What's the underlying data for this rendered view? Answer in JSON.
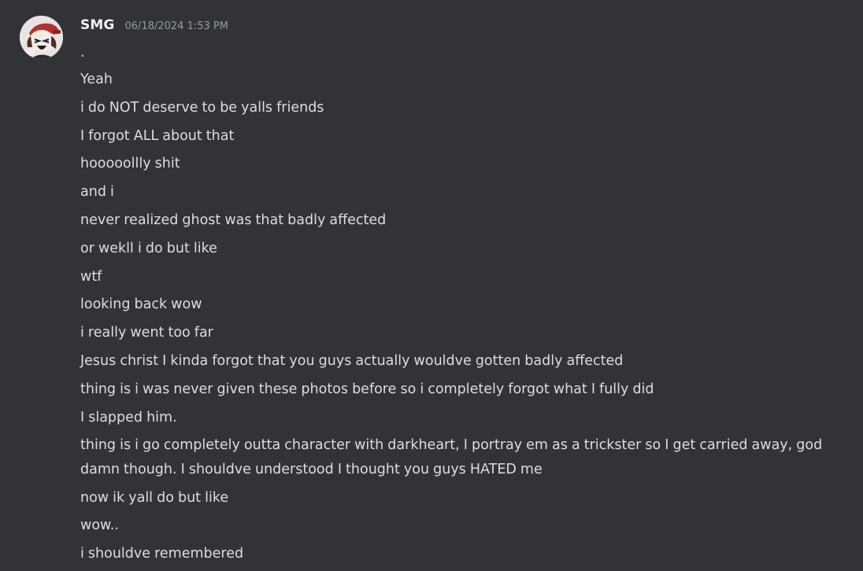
{
  "message": {
    "author": "SMG",
    "timestamp": "06/18/2024 1:53 PM",
    "avatar_icon": "user-avatar",
    "lines": [
      ".",
      "Yeah",
      "i do NOT deserve to be yalls friends",
      "I forgot ALL about that",
      "hooooollly shit",
      "and i",
      "never realized ghost was that badly affected",
      "or wekll i do but like",
      "wtf",
      "looking back wow",
      "i really went too far",
      "Jesus christ I kinda forgot that you guys actually wouldve gotten badly affected",
      "thing is i was never given these photos before so i completely forgot what I fully did",
      "I slapped him.",
      "thing is i go completely outta character with darkheart, I portray em as a trickster so I get carried away, god damn though. I shouldve understood I thought you guys HATED me",
      "now ik yall do but like",
      "wow..",
      "i shouldve remembered"
    ]
  },
  "colors": {
    "background": "#313338",
    "text": "#dbdee1",
    "username": "#f2f3f5",
    "timestamp": "#949ba4"
  }
}
